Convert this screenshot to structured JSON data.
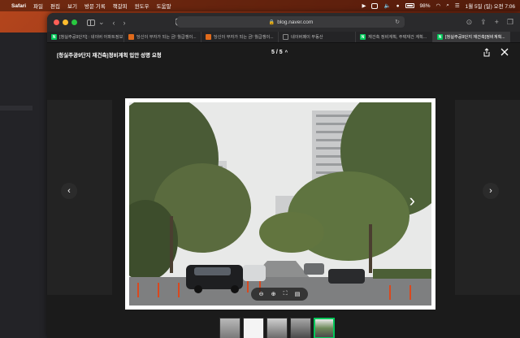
{
  "menubar": {
    "app": "Safari",
    "items": [
      "파일",
      "편집",
      "보기",
      "방문 기록",
      "책갈피",
      "윈도우",
      "도움말"
    ],
    "battery": "98%",
    "datetime": "1월 5일 (일) 오전 7:06"
  },
  "browser": {
    "url": "blog.naver.com",
    "tabs": [
      {
        "label": "[청실주공9단지] : 네이버 아파트정보",
        "fav": "N"
      },
      {
        "label": "당신이 부자가 되는 금! 월급쟁이...",
        "fav": ""
      },
      {
        "label": "당신이 부자가 되는 금! 월급쟁이...",
        "fav": ""
      },
      {
        "label": "네이버페이 부동산",
        "fav": ""
      },
      {
        "label": "재건축 정비계획, 주택재건 계획...",
        "fav": "N"
      },
      {
        "label": "[청실주공9단지 재건축]정비계획...",
        "fav": "N"
      }
    ]
  },
  "viewer": {
    "title": "[청실주공9단지 재건축]정비계획 입안 성명 요청",
    "counter": "5 / 5",
    "current_index": 5,
    "total": 5
  },
  "icons": {
    "share": "share-icon",
    "close": "close-icon",
    "prev": "chevron-left-icon",
    "next": "chevron-right-icon",
    "zoom_out": "zoom-out-icon",
    "zoom_in": "zoom-in-icon",
    "fullscreen": "fullscreen-icon",
    "info": "info-icon"
  },
  "colors": {
    "accent": "#03c75a"
  }
}
